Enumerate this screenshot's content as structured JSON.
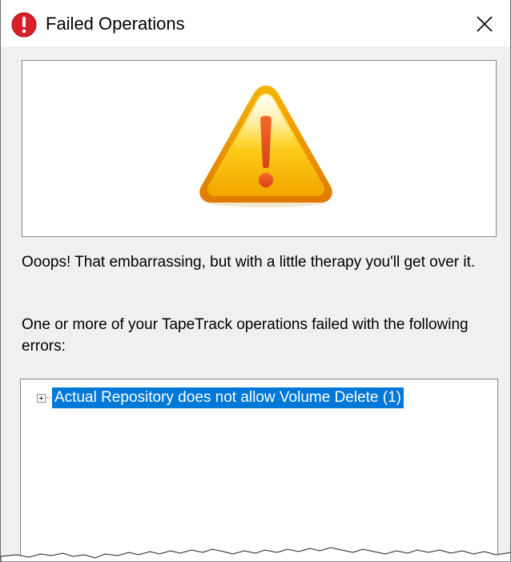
{
  "window": {
    "title": "Failed Operations",
    "title_icon": "error-icon",
    "close_icon": "close-icon"
  },
  "banner": {
    "icon": "warning-triangle-icon",
    "accent_color": "#f5c400"
  },
  "message": {
    "line1": "Ooops! That embarrassing, but with a little therapy you'll get over it.",
    "line2": "One or more of your TapeTrack operations failed with the following errors:"
  },
  "errors_tree": {
    "items": [
      {
        "label": "Actual Repository does not allow Volume Delete (1)",
        "expanded": false,
        "selected": true
      }
    ]
  },
  "colors": {
    "selection": "#0078d7",
    "error_red": "#e81123"
  }
}
